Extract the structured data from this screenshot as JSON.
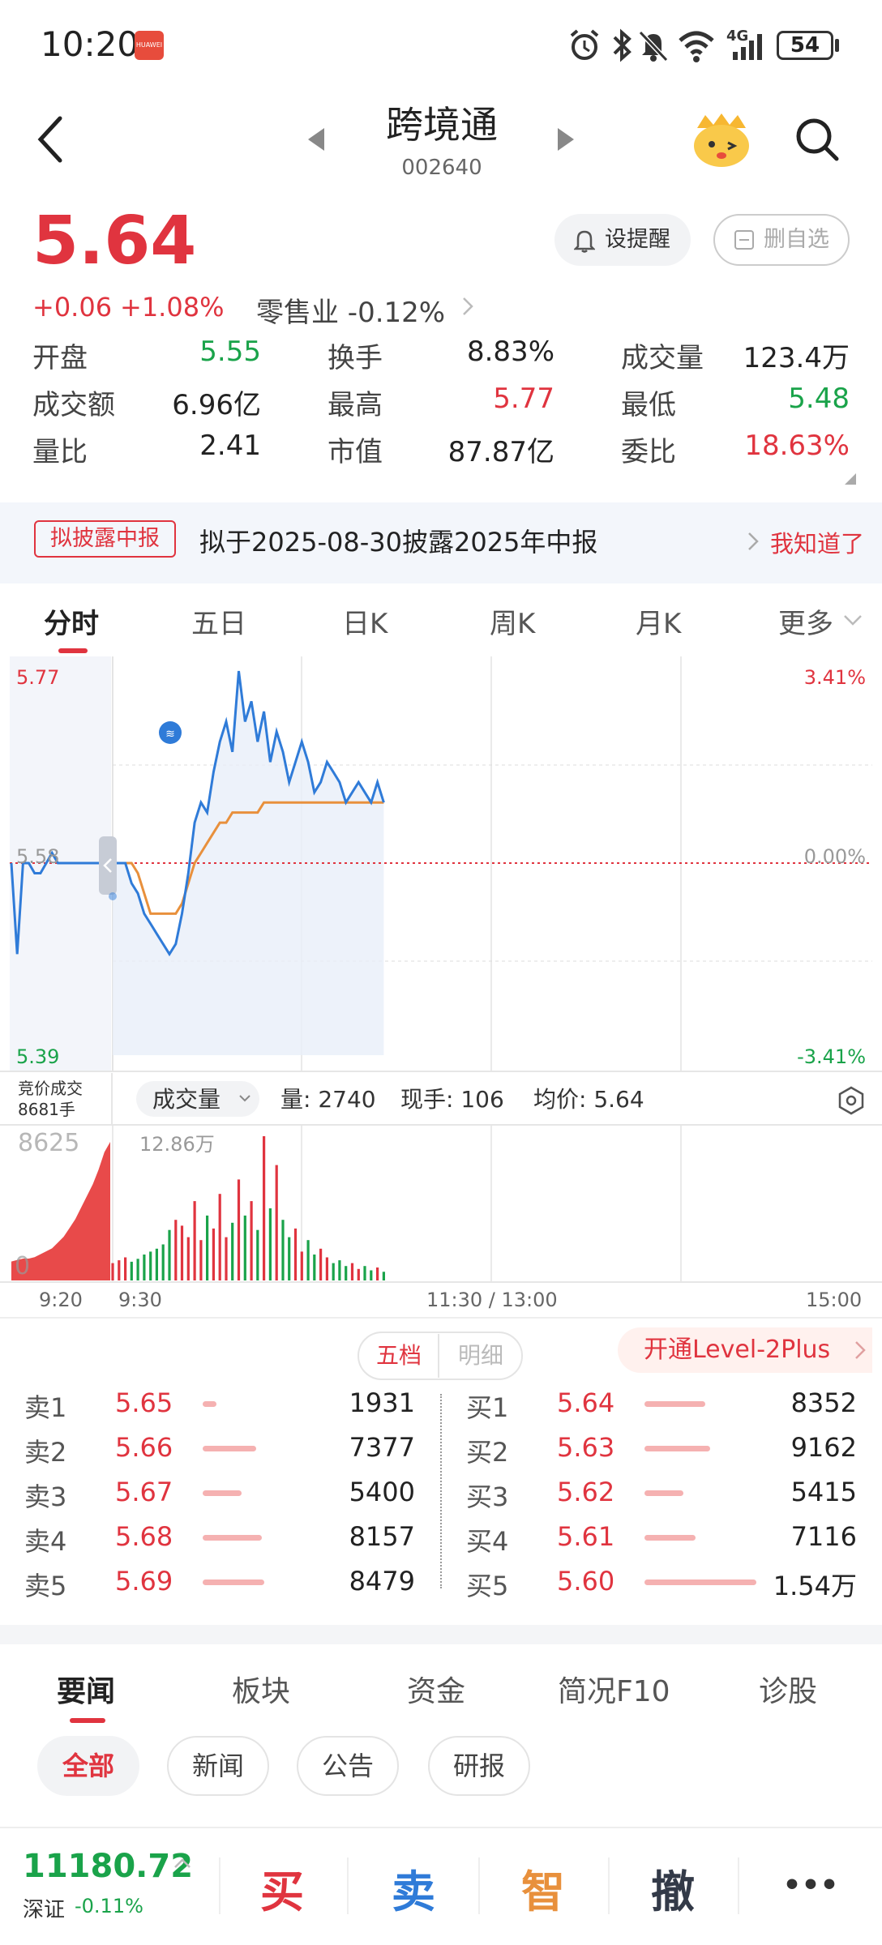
{
  "status_bar": {
    "time": "10:20",
    "badge": "HUAWEI",
    "signal": "4G",
    "battery": "54"
  },
  "header": {
    "name": "跨境通",
    "code": "002640"
  },
  "price": {
    "current": "5.64",
    "change": "+0.06",
    "change_pct": "+1.08%",
    "sector": "零售业 -0.12%"
  },
  "buttons": {
    "alert": "设提醒",
    "favorite": "删自选"
  },
  "quote": [
    [
      {
        "label": "开盘",
        "value": "5.55",
        "color": "green"
      },
      {
        "label": "换手",
        "value": "8.83%",
        "color": "dark"
      },
      {
        "label": "成交量",
        "value": "123.4万",
        "color": "dark"
      }
    ],
    [
      {
        "label": "成交额",
        "value": "6.96亿",
        "color": "dark"
      },
      {
        "label": "最高",
        "value": "5.77",
        "color": "red"
      },
      {
        "label": "最低",
        "value": "5.48",
        "color": "green"
      }
    ],
    [
      {
        "label": "量比",
        "value": "2.41",
        "color": "dark"
      },
      {
        "label": "市值",
        "value": "87.87亿",
        "color": "dark"
      },
      {
        "label": "委比",
        "value": "18.63%",
        "color": "red"
      }
    ]
  ],
  "banner": {
    "tag": "拟披露中报",
    "text": "拟于2025-08-30披露2025年中报",
    "action": "我知道了"
  },
  "period_tabs": [
    "分时",
    "五日",
    "日K",
    "周K",
    "月K",
    "更多"
  ],
  "chart_data": {
    "type": "line",
    "price_axis": {
      "high": "5.77",
      "mid": "5.58",
      "low": "5.39",
      "high_pct": "3.41%",
      "mid_pct": "0.00%",
      "low_pct": "-3.41%"
    },
    "ylim": [
      5.39,
      5.77
    ],
    "prev_close": 5.58,
    "x_labels": [
      "9:20",
      "9:30",
      "11:30 / 13:00",
      "15:00"
    ],
    "auction": {
      "label": "竞价成交",
      "volume": "8681手"
    },
    "volume_panel": {
      "selector": "成交量",
      "stats": {
        "volume": "量: 2740",
        "current": "现手: 106",
        "avg": "均价: 5.64"
      },
      "left_label": "8625",
      "peak_label": "12.86万",
      "zero_label": "0"
    },
    "series": [
      {
        "name": "price",
        "color": "#2f7bd8",
        "values": [
          5.58,
          5.58,
          5.58,
          5.56,
          5.55,
          5.53,
          5.52,
          5.51,
          5.5,
          5.49,
          5.5,
          5.53,
          5.57,
          5.62,
          5.64,
          5.63,
          5.67,
          5.7,
          5.72,
          5.69,
          5.77,
          5.72,
          5.74,
          5.7,
          5.73,
          5.68,
          5.71,
          5.69,
          5.66,
          5.68,
          5.7,
          5.68,
          5.65,
          5.66,
          5.68,
          5.67,
          5.66,
          5.64,
          5.65,
          5.66,
          5.65,
          5.64,
          5.66,
          5.64
        ]
      },
      {
        "name": "avg",
        "color": "#e8903c",
        "values": [
          5.58,
          5.58,
          5.58,
          5.58,
          5.57,
          5.55,
          5.53,
          5.53,
          5.53,
          5.53,
          5.53,
          5.54,
          5.56,
          5.58,
          5.59,
          5.6,
          5.61,
          5.62,
          5.62,
          5.63,
          5.63,
          5.63,
          5.63,
          5.63,
          5.64,
          5.64,
          5.64,
          5.64,
          5.64,
          5.64,
          5.64,
          5.64,
          5.64,
          5.64,
          5.64,
          5.64,
          5.64,
          5.64,
          5.64,
          5.64,
          5.64,
          5.64,
          5.64,
          5.64
        ]
      }
    ],
    "premarket_values": [
      5.58,
      5.49,
      5.58,
      5.58,
      5.57,
      5.57,
      5.58,
      5.59,
      5.58,
      5.58,
      5.58,
      5.58,
      5.58,
      5.58,
      5.58,
      5.58,
      5.58,
      5.58
    ],
    "volume_values": [
      0.12,
      0.14,
      0.16,
      0.13,
      0.15,
      0.18,
      0.2,
      0.22,
      0.25,
      0.35,
      0.42,
      0.38,
      0.3,
      0.55,
      0.28,
      0.45,
      0.36,
      0.6,
      0.3,
      0.4,
      0.7,
      0.45,
      0.55,
      0.35,
      1.0,
      0.5,
      0.8,
      0.42,
      0.3,
      0.36,
      0.2,
      0.28,
      0.18,
      0.22,
      0.16,
      0.12,
      0.14,
      0.1,
      0.12,
      0.08,
      0.1,
      0.07,
      0.09,
      0.06
    ],
    "premarket_volume": [
      0.13,
      0.14,
      0.15,
      0.15,
      0.16,
      0.18,
      0.2,
      0.22,
      0.26,
      0.3,
      0.36,
      0.42,
      0.5,
      0.58,
      0.66,
      0.76,
      0.88,
      0.95
    ]
  },
  "order_book": {
    "tab_5": "五档",
    "tab_detail": "明细",
    "level2": "开通Level-2Plus",
    "sell": [
      {
        "label": "卖1",
        "price": "5.65",
        "qty": "1931",
        "ratio": 0.12
      },
      {
        "label": "卖2",
        "price": "5.66",
        "qty": "7377",
        "ratio": 0.48
      },
      {
        "label": "卖3",
        "price": "5.67",
        "qty": "5400",
        "ratio": 0.35
      },
      {
        "label": "卖4",
        "price": "5.68",
        "qty": "8157",
        "ratio": 0.53
      },
      {
        "label": "卖5",
        "price": "5.69",
        "qty": "8479",
        "ratio": 0.55
      }
    ],
    "buy": [
      {
        "label": "买1",
        "price": "5.64",
        "qty": "8352",
        "ratio": 0.54
      },
      {
        "label": "买2",
        "price": "5.63",
        "qty": "9162",
        "ratio": 0.59
      },
      {
        "label": "买3",
        "price": "5.62",
        "qty": "5415",
        "ratio": 0.35
      },
      {
        "label": "买4",
        "price": "5.61",
        "qty": "7116",
        "ratio": 0.46
      },
      {
        "label": "买5",
        "price": "5.60",
        "qty": "1.54万",
        "ratio": 1.0
      }
    ]
  },
  "news_tabs": [
    "要闻",
    "板块",
    "资金",
    "简况F10",
    "诊股"
  ],
  "news_chips": [
    "全部",
    "新闻",
    "公告",
    "研报"
  ],
  "bottom_bar": {
    "index_value": "11180.72",
    "index_name": "深证",
    "index_change": "-0.11%",
    "buy": "买",
    "sell": "卖",
    "smart": "智",
    "cancel": "撤",
    "more": "•••"
  },
  "colors": {
    "red": "#e0343f",
    "green": "#1aa34a",
    "blue": "#2f7bd8",
    "orange": "#e8903c",
    "smart": "#e8903c",
    "cancel": "#333a48"
  }
}
